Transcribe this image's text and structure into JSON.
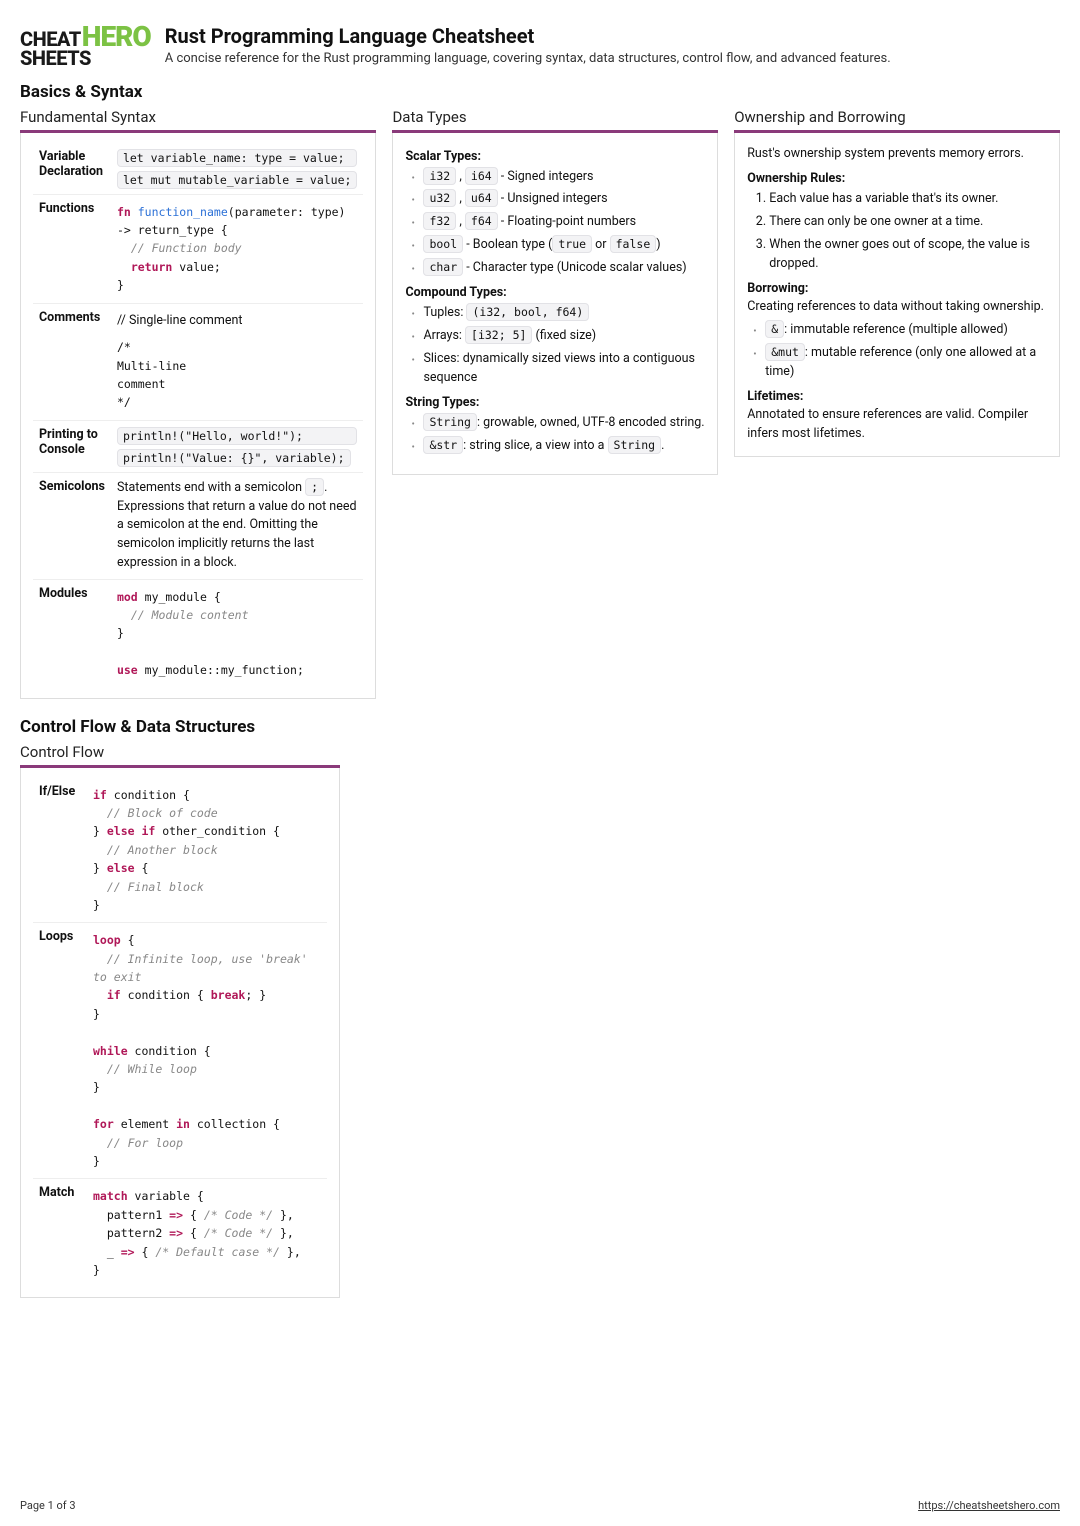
{
  "logo": {
    "l1a": "CHEAT",
    "l1b": "HERO",
    "l2": "SHEETS"
  },
  "header": {
    "title": "Rust Programming Language Cheatsheet",
    "subtitle": "A concise reference for the Rust programming language, covering syntax, data structures, control flow, and advanced features."
  },
  "sec1": {
    "title": "Basics & Syntax",
    "cardA": {
      "title": "Fundamental Syntax",
      "rows": {
        "r1k": "Variable Declaration",
        "r1a": "let variable_name: type = value;",
        "r1b": "let mut mutable_variable = value;",
        "r2k": "Functions",
        "r3k": "Comments",
        "r3a": "// Single-line comment",
        "r3b": "/*\nMulti-line\ncomment\n*/",
        "r4k": "Printing to Console",
        "r4a": "println!(\"Hello, world!\");",
        "r4b": "println!(\"Value: {}\", variable);",
        "r5k": "Semicolons",
        "r5a": "Statements end with a semicolon ",
        "r5code": ";",
        "r5b": ". Expressions that return a value do not need a semicolon at the end. Omitting the semicolon implicitly returns the last expression in a block.",
        "r6k": "Modules"
      }
    },
    "cardB": {
      "title": "Data Types",
      "scalar": "Scalar Types:",
      "s1a": "i32",
      "s1b": "i64",
      "s1t": " - Signed integers",
      "s2a": "u32",
      "s2b": "u64",
      "s2t": " - Unsigned integers",
      "s3a": "f32",
      "s3b": "f64",
      "s3t": " - Floating-point numbers",
      "s4a": "bool",
      "s4t": " - Boolean type (",
      "s4b": "true",
      "s4c": " or ",
      "s4d": "false",
      "s4e": ")",
      "s5a": "char",
      "s5t": " - Character type (Unicode scalar values)",
      "compound": "Compound Types:",
      "c1t": "Tuples: ",
      "c1a": "(i32, bool, f64)",
      "c2t": "Arrays: ",
      "c2a": "[i32; 5]",
      "c2b": " (fixed size)",
      "c3t": "Slices: dynamically sized views into a contiguous sequence",
      "string": "String Types:",
      "st1a": "String",
      "st1t": ": growable, owned, UTF-8 encoded string.",
      "st2a": "&str",
      "st2t": ": string slice, a view into a ",
      "st2b": "String",
      "st2c": "."
    },
    "cardC": {
      "title": "Ownership and Borrowing",
      "intro": "Rust's ownership system prevents memory errors.",
      "rulesH": "Ownership Rules:",
      "r1": "Each value has a variable that's its owner.",
      "r2": "There can only be one owner at a time.",
      "r3": "When the owner goes out of scope, the value is dropped.",
      "borrowH": "Borrowing:",
      "borrowT": "Creating references to data without taking ownership.",
      "b1a": "&",
      "b1t": ": immutable reference (multiple allowed)",
      "b2a": "&mut",
      "b2t": ": mutable reference (only one allowed at a time)",
      "lifeH": "Lifetimes:",
      "lifeT": "Annotated to ensure references are valid. Compiler infers most lifetimes."
    }
  },
  "sec2": {
    "title": "Control Flow & Data Structures",
    "cardA": {
      "title": "Control Flow",
      "r1k": "If/Else",
      "r2k": "Loops",
      "r3k": "Match"
    }
  },
  "footer": {
    "page": "Page 1 of 3",
    "url": "https://cheatsheetshero.com"
  }
}
